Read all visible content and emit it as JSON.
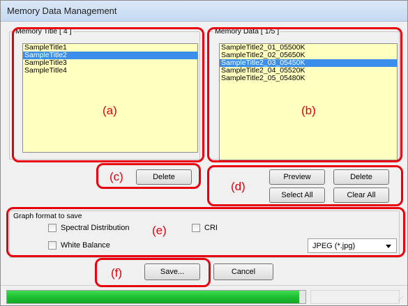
{
  "window": {
    "title": "Memory Data Management"
  },
  "memory_title_group": {
    "legend": "Memory Title [ 4 ]",
    "items": [
      {
        "label": "SampleTitle1",
        "selected": false
      },
      {
        "label": "SampleTitle2",
        "selected": true
      },
      {
        "label": "SampleTitle3",
        "selected": false
      },
      {
        "label": "SampleTitle4",
        "selected": false
      }
    ],
    "annotation": "(a)"
  },
  "memory_data_group": {
    "legend": "Memory Data [ 1/5 ]",
    "items": [
      {
        "label": "SampleTitle2_01_05500K",
        "selected": false
      },
      {
        "label": "SampleTitle2_02_05650K",
        "selected": false
      },
      {
        "label": "SampleTitle2_03_05450K",
        "selected": true
      },
      {
        "label": "SampleTitle2_04_05520K",
        "selected": false
      },
      {
        "label": "SampleTitle2_05_05480K",
        "selected": false
      }
    ],
    "annotation": "(b)"
  },
  "title_actions": {
    "annotation": "(c)",
    "delete_label": "Delete"
  },
  "data_actions": {
    "annotation": "(d)",
    "preview_label": "Preview",
    "delete_label": "Delete",
    "select_all_label": "Select All",
    "clear_all_label": "Clear All"
  },
  "graph_format": {
    "legend": "Graph format to save",
    "annotation": "(e)",
    "spectral_label": "Spectral Distribution",
    "spectral_checked": false,
    "cri_label": "CRI",
    "cri_checked": false,
    "white_balance_label": "White Balance",
    "white_balance_checked": false,
    "format_selected": "JPEG (*.jpg)"
  },
  "footer": {
    "annotation": "(f)",
    "save_label": "Save...",
    "cancel_label": "Cancel"
  },
  "status": {
    "progress_fraction": 0.98
  },
  "colors": {
    "annotation": "#e8000e",
    "list_bg": "#ffffc0",
    "selection": "#3b8fea",
    "progress": "#1fbf31"
  },
  "icons": {
    "dropdown": "chevron-down-icon",
    "grip": "resize-grip-icon"
  }
}
